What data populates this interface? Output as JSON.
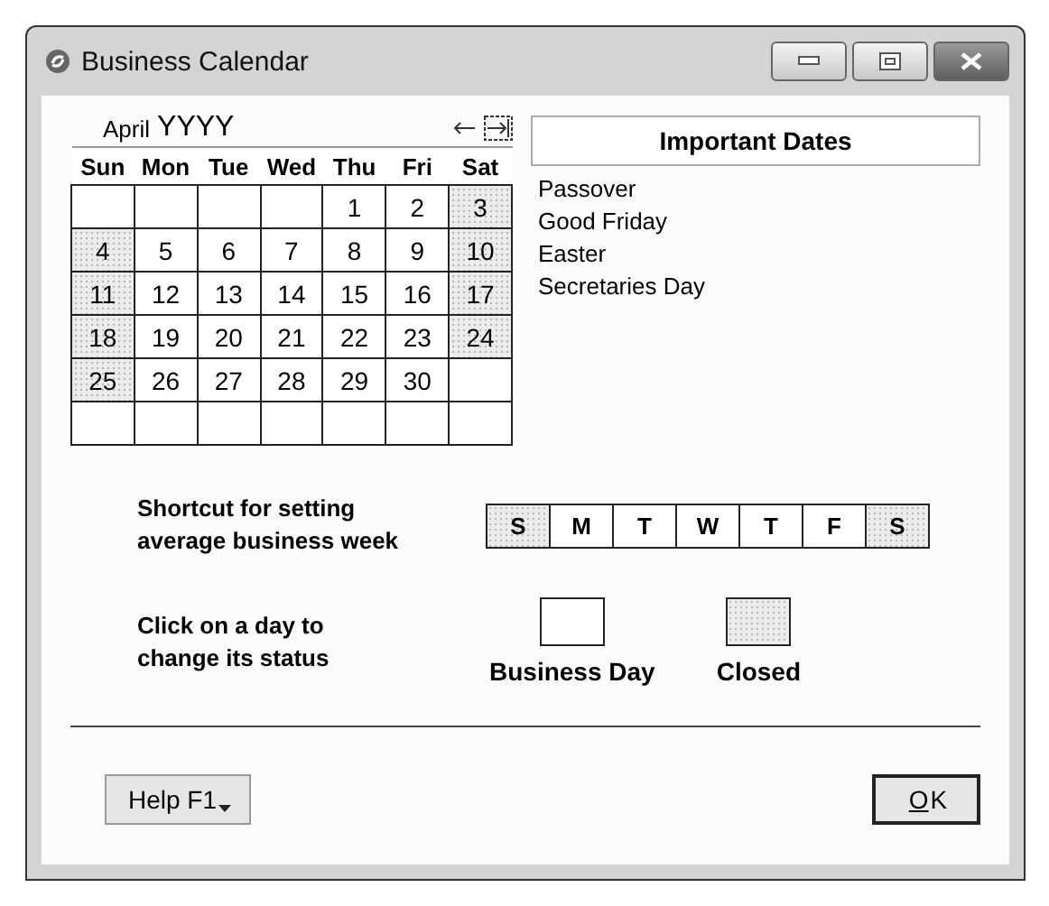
{
  "window": {
    "title": "Business Calendar"
  },
  "calendar": {
    "month": "April",
    "year": "YYYY",
    "weekdays": [
      "Sun",
      "Mon",
      "Tue",
      "Wed",
      "Thu",
      "Fri",
      "Sat"
    ],
    "weeks": [
      [
        {
          "closed": false
        },
        {
          "closed": false
        },
        {
          "closed": false
        },
        {
          "closed": false
        },
        {
          "day": "1",
          "closed": false
        },
        {
          "day": "2",
          "closed": false
        },
        {
          "day": "3",
          "closed": true
        }
      ],
      [
        {
          "day": "4",
          "closed": true
        },
        {
          "day": "5",
          "closed": false
        },
        {
          "day": "6",
          "closed": false
        },
        {
          "day": "7",
          "closed": false
        },
        {
          "day": "8",
          "closed": false
        },
        {
          "day": "9",
          "closed": false
        },
        {
          "day": "10",
          "closed": true
        }
      ],
      [
        {
          "day": "11",
          "closed": true
        },
        {
          "day": "12",
          "closed": false
        },
        {
          "day": "13",
          "closed": false
        },
        {
          "day": "14",
          "closed": false
        },
        {
          "day": "15",
          "closed": false
        },
        {
          "day": "16",
          "closed": false
        },
        {
          "day": "17",
          "closed": true
        }
      ],
      [
        {
          "day": "18",
          "closed": true
        },
        {
          "day": "19",
          "closed": false
        },
        {
          "day": "20",
          "closed": false
        },
        {
          "day": "21",
          "closed": false
        },
        {
          "day": "22",
          "closed": false
        },
        {
          "day": "23",
          "closed": false
        },
        {
          "day": "24",
          "closed": true
        }
      ],
      [
        {
          "day": "25",
          "closed": true
        },
        {
          "day": "26",
          "closed": false
        },
        {
          "day": "27",
          "closed": false
        },
        {
          "day": "28",
          "closed": false
        },
        {
          "day": "29",
          "closed": false
        },
        {
          "day": "30",
          "closed": false
        },
        {
          "closed": false
        }
      ],
      [
        {
          "closed": false
        },
        {
          "closed": false
        },
        {
          "closed": false
        },
        {
          "closed": false
        },
        {
          "closed": false
        },
        {
          "closed": false
        },
        {
          "closed": false
        }
      ]
    ]
  },
  "important_dates": {
    "title": "Important Dates",
    "items": [
      "Passover",
      "Good Friday",
      "Easter",
      "Secretaries Day"
    ]
  },
  "shortcut": {
    "label": "Shortcut for setting average business week",
    "days": [
      {
        "label": "S",
        "closed": true
      },
      {
        "label": "M",
        "closed": false
      },
      {
        "label": "T",
        "closed": false
      },
      {
        "label": "W",
        "closed": false
      },
      {
        "label": "T",
        "closed": false
      },
      {
        "label": "F",
        "closed": false
      },
      {
        "label": "S",
        "closed": true
      }
    ]
  },
  "legend": {
    "hint": "Click on a day to change its status",
    "items": [
      {
        "label": "Business Day",
        "closed": false
      },
      {
        "label": "Closed",
        "closed": true
      }
    ]
  },
  "buttons": [
    {
      "kind": "help",
      "label": "Help F1",
      "default": false
    },
    {
      "kind": "ok",
      "label": "OK",
      "default": true,
      "underline_first": true
    }
  ]
}
